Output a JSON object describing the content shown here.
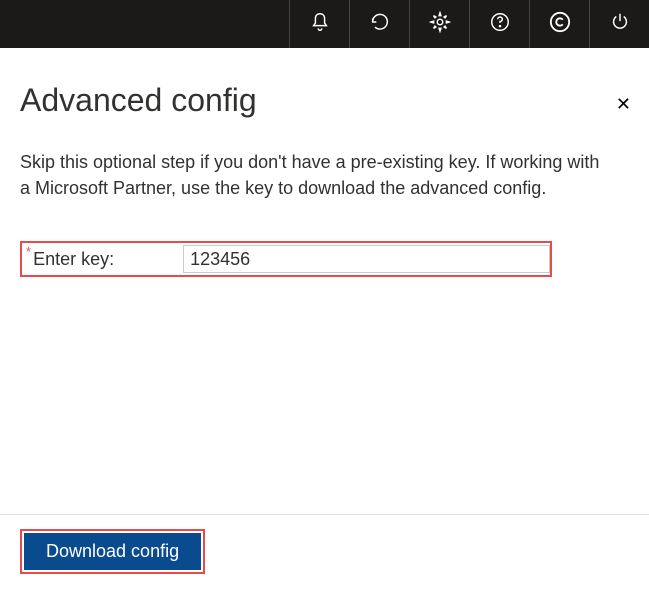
{
  "topbar": {
    "icons": {
      "notifications": "notifications-icon",
      "refresh": "refresh-icon",
      "settings": "settings-icon",
      "help": "help-icon",
      "copyright": "copyright-icon",
      "power": "power-icon"
    }
  },
  "dialog": {
    "title": "Advanced config",
    "close_label": "✕",
    "description": "Skip this optional step if you don't have a pre-existing key. If working with a Microsoft Partner, use the key to download the advanced config.",
    "required_marker": "*",
    "key_label": "Enter key:",
    "key_value": "123456",
    "download_label": "Download config"
  }
}
